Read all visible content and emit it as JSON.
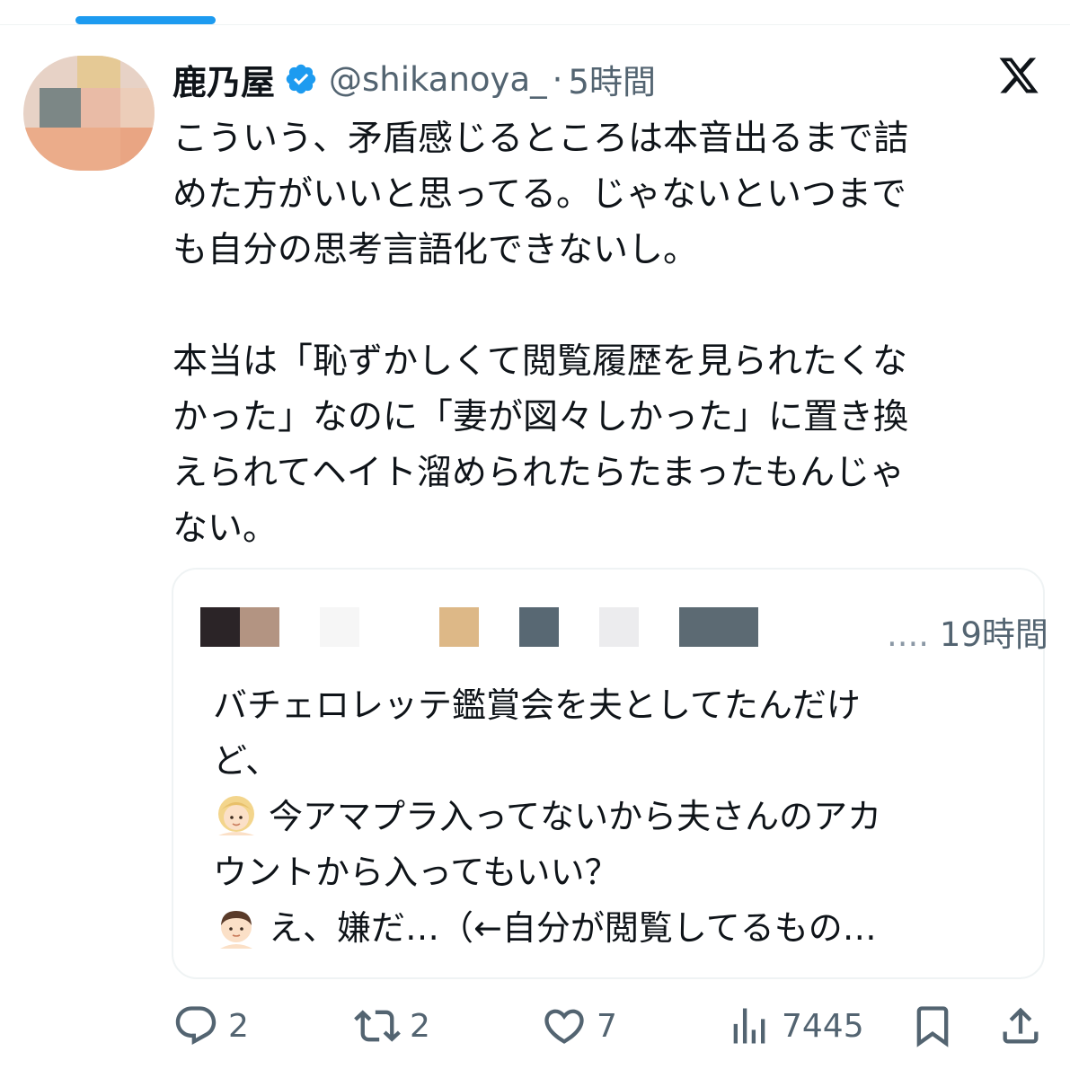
{
  "tweet": {
    "display_name": "鹿乃屋",
    "handle": "@shikanoya_",
    "separator": "·",
    "time": "5時間",
    "body_lines": [
      "こういう、矛盾感じるところは本音出るまで詰",
      "めた方がいいと思ってる。じゃないといつまで",
      "も自分の思考言語化できないし。",
      "",
      "本当は「恥ずかしくて閲覧履歴を見られたくな",
      "かった」なのに「妻が図々しかった」に置き換",
      "えられてヘイト溜められたらたまったもんじゃ",
      "ない。"
    ]
  },
  "quote": {
    "ellipsis": "....",
    "time": "19時間",
    "line1": "バチェロレッテ鑑賞会を夫としてたんだけ",
    "line2": "ど、",
    "line3": "今アマプラ入ってないから夫さんのアカ",
    "line4": "ウントから入ってもいい？",
    "line5": "え、嫌だ…（←自分が閲覧してるもの…",
    "emoji_1": "woman-blonde-emoji",
    "emoji_2": "man-emoji"
  },
  "actions": {
    "reply_count": "2",
    "retweet_count": "2",
    "like_count": "7",
    "views_count": "7445"
  },
  "icons": {
    "verified": "verified-badge-icon",
    "x_logo": "x-logo-icon",
    "reply": "reply-icon",
    "retweet": "retweet-icon",
    "like": "heart-icon",
    "views": "views-icon",
    "bookmark": "bookmark-icon",
    "share": "share-icon"
  },
  "colors": {
    "accent": "#1d9bf0",
    "text": "#0f1419",
    "secondary": "#536471",
    "border": "#eff3f4"
  }
}
